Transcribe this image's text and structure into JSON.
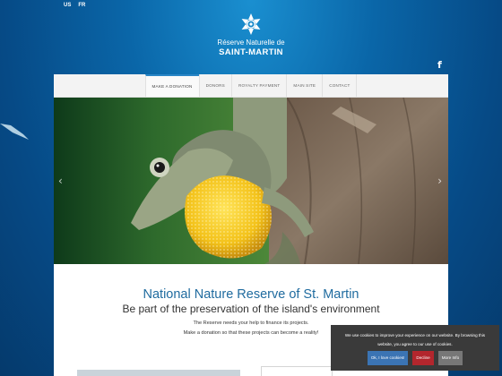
{
  "lang": {
    "us": "US",
    "fr": "FR"
  },
  "logo": {
    "line1": "Réserve Naturelle de",
    "line2": "SAINT-MARTIN"
  },
  "nav": {
    "items": [
      {
        "label": "MAKE A DONATION",
        "active": true
      },
      {
        "label": "DONORS",
        "active": false
      },
      {
        "label": "ROYALTY PAYMENT",
        "active": false
      },
      {
        "label": "MAIN SITE",
        "active": false
      },
      {
        "label": "CONTACT",
        "active": false
      }
    ]
  },
  "social": {
    "facebook": "f"
  },
  "slider": {
    "prev": "‹",
    "next": "›",
    "image": "anole lizard with yellow dewlap on tree bark"
  },
  "main": {
    "title": "National Nature Reserve of St. Martin",
    "subtitle": "Be part of the preservation of the island's environment",
    "line1": "The Reserve needs your help to finance its projects.",
    "line2": "Make a donation so that these projects can become a reality!"
  },
  "cookie": {
    "text1": "We use cookies to improve your experience on our website. By browsing this",
    "text2": "website, you agree to our use of cookies.",
    "ok": "Ok, I love cookies!",
    "decline": "Decline",
    "more": "More Info"
  },
  "colors": {
    "accent": "#2a86c6",
    "title": "#1f6b9f",
    "ok": "#3b74b4",
    "decline": "#b3262d"
  }
}
